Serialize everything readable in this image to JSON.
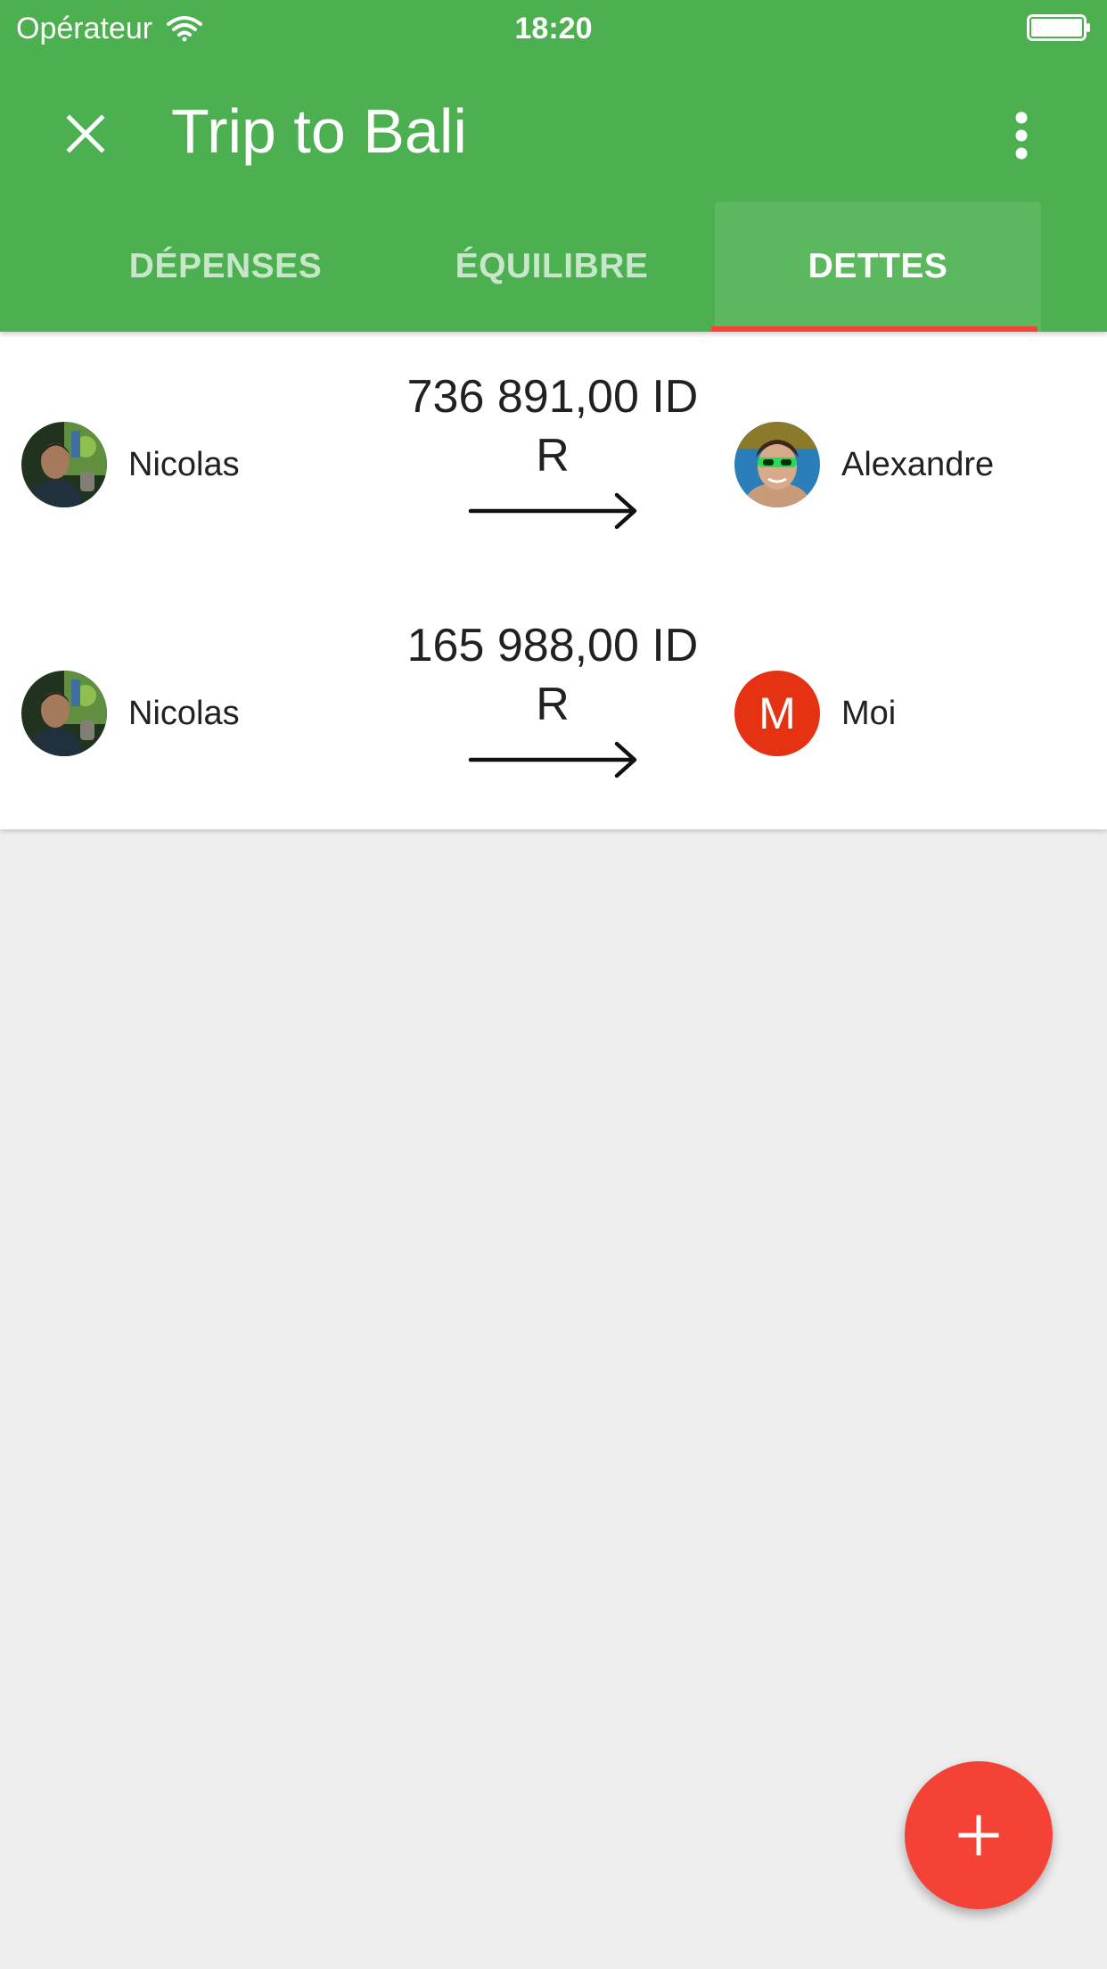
{
  "status_bar": {
    "carrier": "Opérateur",
    "time": "18:20",
    "wifi_icon": "wifi-icon",
    "battery_icon": "battery-icon"
  },
  "toolbar": {
    "title": "Trip to Bali",
    "close_icon": "close-icon",
    "more_icon": "more-vertical-icon"
  },
  "tabs": [
    {
      "label": "DÉPENSES",
      "selected": false
    },
    {
      "label": "ÉQUILIBRE",
      "selected": false
    },
    {
      "label": "DETTES",
      "selected": true
    }
  ],
  "debts": [
    {
      "from": {
        "name": "Nicolas",
        "avatar": "photo"
      },
      "amount": "736 891,00 IDR",
      "to": {
        "name": "Alexandre",
        "avatar": "photo"
      }
    },
    {
      "from": {
        "name": "Nicolas",
        "avatar": "photo"
      },
      "amount": "165 988,00 IDR",
      "to": {
        "name": "Moi",
        "avatar_letter": "M",
        "avatar_color": "#e53212"
      }
    }
  ],
  "fab": {
    "icon": "plus-icon"
  },
  "colors": {
    "app_bar": "#4caf50",
    "tab_indicator": "#f44336",
    "fab": "#f44336",
    "background": "#eeeeee"
  }
}
